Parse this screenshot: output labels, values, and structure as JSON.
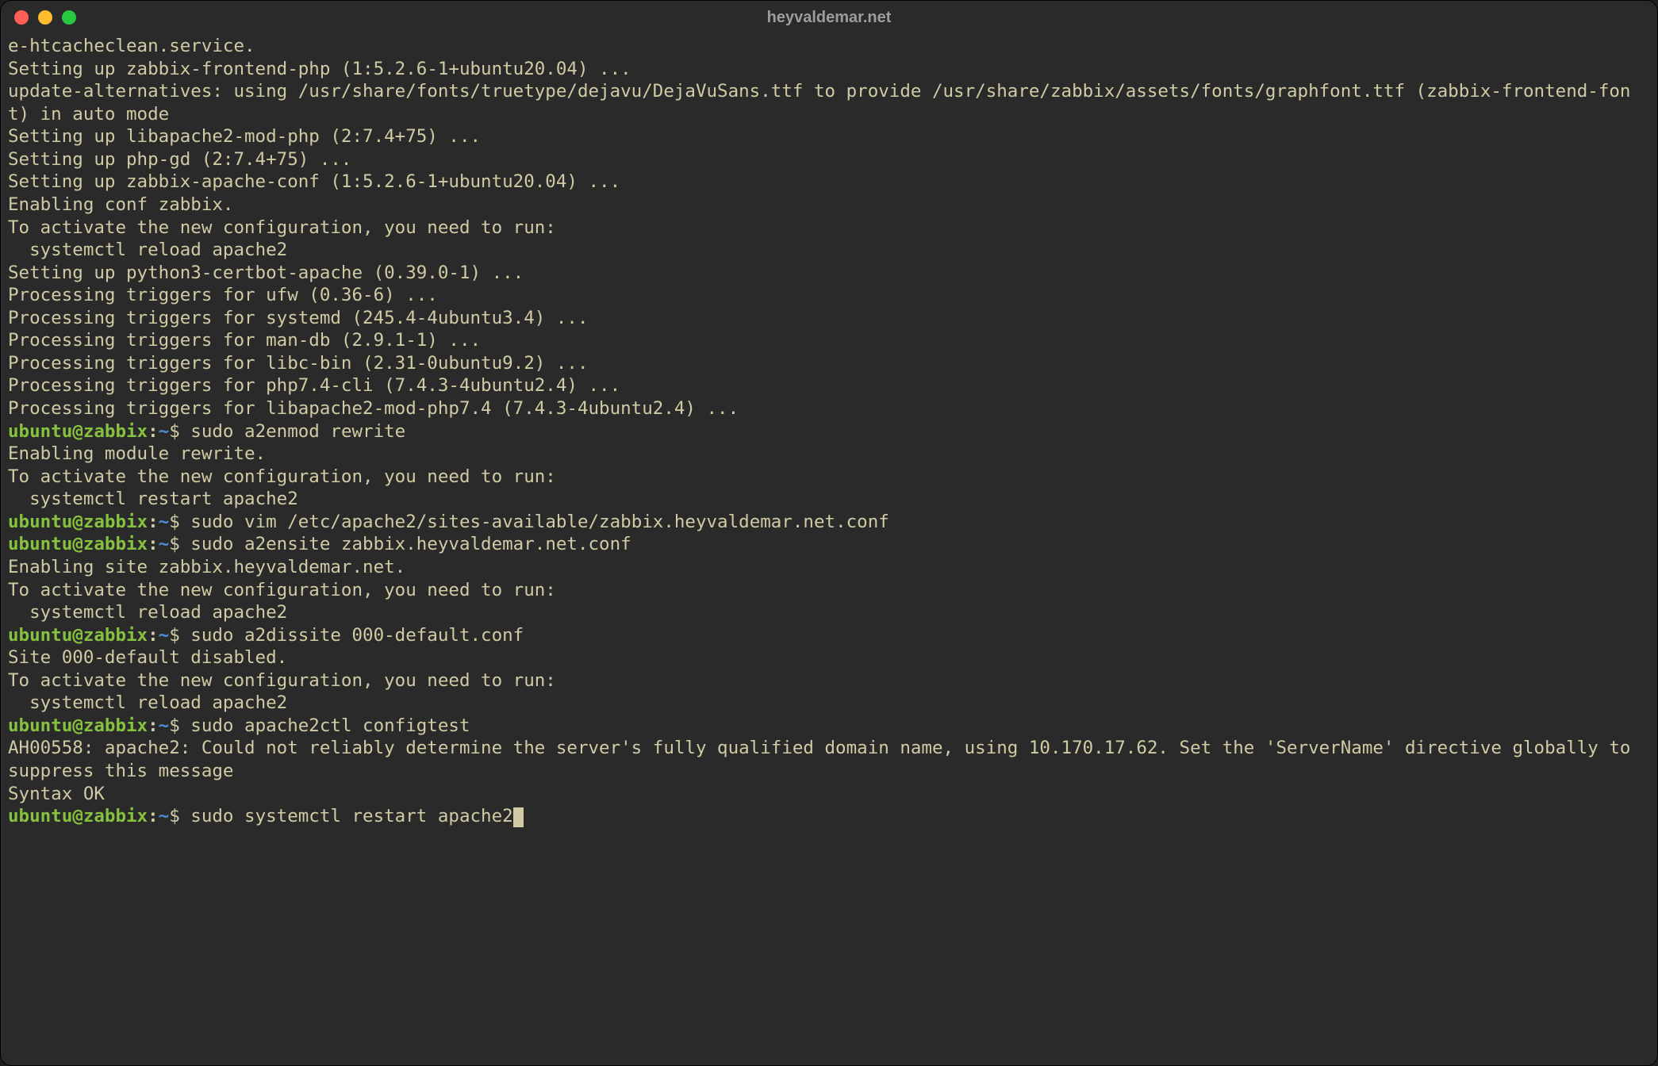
{
  "window": {
    "title": "heyvaldemar.net"
  },
  "prompt": {
    "user_host": "ubuntu@zabbix",
    "sep": ":",
    "path": "~",
    "dollar": "$"
  },
  "lines": [
    {
      "t": "out",
      "text": "e-htcacheclean.service."
    },
    {
      "t": "out",
      "text": "Setting up zabbix-frontend-php (1:5.2.6-1+ubuntu20.04) ..."
    },
    {
      "t": "out",
      "text": "update-alternatives: using /usr/share/fonts/truetype/dejavu/DejaVuSans.ttf to provide /usr/share/zabbix/assets/fonts/graphfont.ttf (zabbix-frontend-font) in auto mode"
    },
    {
      "t": "out",
      "text": "Setting up libapache2-mod-php (2:7.4+75) ..."
    },
    {
      "t": "out",
      "text": "Setting up php-gd (2:7.4+75) ..."
    },
    {
      "t": "out",
      "text": "Setting up zabbix-apache-conf (1:5.2.6-1+ubuntu20.04) ..."
    },
    {
      "t": "out",
      "text": "Enabling conf zabbix."
    },
    {
      "t": "out",
      "text": "To activate the new configuration, you need to run:"
    },
    {
      "t": "out",
      "text": "  systemctl reload apache2"
    },
    {
      "t": "out",
      "text": "Setting up python3-certbot-apache (0.39.0-1) ..."
    },
    {
      "t": "out",
      "text": "Processing triggers for ufw (0.36-6) ..."
    },
    {
      "t": "out",
      "text": "Processing triggers for systemd (245.4-4ubuntu3.4) ..."
    },
    {
      "t": "out",
      "text": "Processing triggers for man-db (2.9.1-1) ..."
    },
    {
      "t": "out",
      "text": "Processing triggers for libc-bin (2.31-0ubuntu9.2) ..."
    },
    {
      "t": "out",
      "text": "Processing triggers for php7.4-cli (7.4.3-4ubuntu2.4) ..."
    },
    {
      "t": "out",
      "text": "Processing triggers for libapache2-mod-php7.4 (7.4.3-4ubuntu2.4) ..."
    },
    {
      "t": "cmd",
      "text": "sudo a2enmod rewrite"
    },
    {
      "t": "out",
      "text": "Enabling module rewrite."
    },
    {
      "t": "out",
      "text": "To activate the new configuration, you need to run:"
    },
    {
      "t": "out",
      "text": "  systemctl restart apache2"
    },
    {
      "t": "cmd",
      "text": "sudo vim /etc/apache2/sites-available/zabbix.heyvaldemar.net.conf"
    },
    {
      "t": "cmd",
      "text": "sudo a2ensite zabbix.heyvaldemar.net.conf"
    },
    {
      "t": "out",
      "text": "Enabling site zabbix.heyvaldemar.net."
    },
    {
      "t": "out",
      "text": "To activate the new configuration, you need to run:"
    },
    {
      "t": "out",
      "text": "  systemctl reload apache2"
    },
    {
      "t": "cmd",
      "text": "sudo a2dissite 000-default.conf"
    },
    {
      "t": "out",
      "text": "Site 000-default disabled."
    },
    {
      "t": "out",
      "text": "To activate the new configuration, you need to run:"
    },
    {
      "t": "out",
      "text": "  systemctl reload apache2"
    },
    {
      "t": "cmd",
      "text": "sudo apache2ctl configtest"
    },
    {
      "t": "out",
      "text": "AH00558: apache2: Could not reliably determine the server's fully qualified domain name, using 10.170.17.62. Set the 'ServerName' directive globally to suppress this message"
    },
    {
      "t": "out",
      "text": "Syntax OK"
    },
    {
      "t": "cmd",
      "text": "sudo systemctl restart apache2",
      "cursor": true
    }
  ]
}
